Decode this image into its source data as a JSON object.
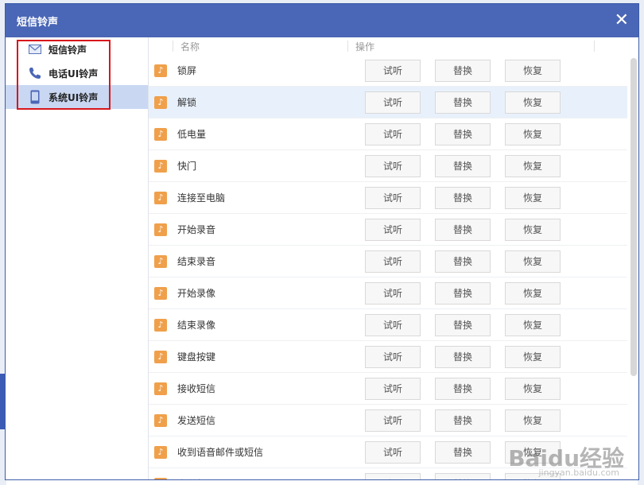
{
  "window": {
    "title": "短信铃声",
    "close_icon": "close-icon",
    "accent": "#4a66b6"
  },
  "sidebar": {
    "items": [
      {
        "label": "短信铃声",
        "icon": "envelope-icon"
      },
      {
        "label": "电话UI铃声",
        "icon": "phone-icon"
      },
      {
        "label": "系统UI铃声",
        "icon": "device-icon",
        "active": true
      }
    ],
    "highlight_color": "#d8161b"
  },
  "table": {
    "headers": {
      "name": "名称",
      "operation": "操作"
    },
    "buttons": {
      "listen": "试听",
      "replace": "替换",
      "restore": "恢复"
    },
    "rows": [
      {
        "name": "锁屏"
      },
      {
        "name": "解锁",
        "selected": true
      },
      {
        "name": "低电量"
      },
      {
        "name": "快门"
      },
      {
        "name": "连接至电脑"
      },
      {
        "name": "开始录音"
      },
      {
        "name": "结束录音"
      },
      {
        "name": "开始录像"
      },
      {
        "name": "结束录像"
      },
      {
        "name": "键盘按键"
      },
      {
        "name": "接收短信"
      },
      {
        "name": "发送短信"
      },
      {
        "name": "收到语音邮件或短信"
      },
      {
        "name": "发送邮件"
      }
    ]
  },
  "watermark": {
    "main": "Baidu经验",
    "sub": "jingyan.baidu.com"
  }
}
